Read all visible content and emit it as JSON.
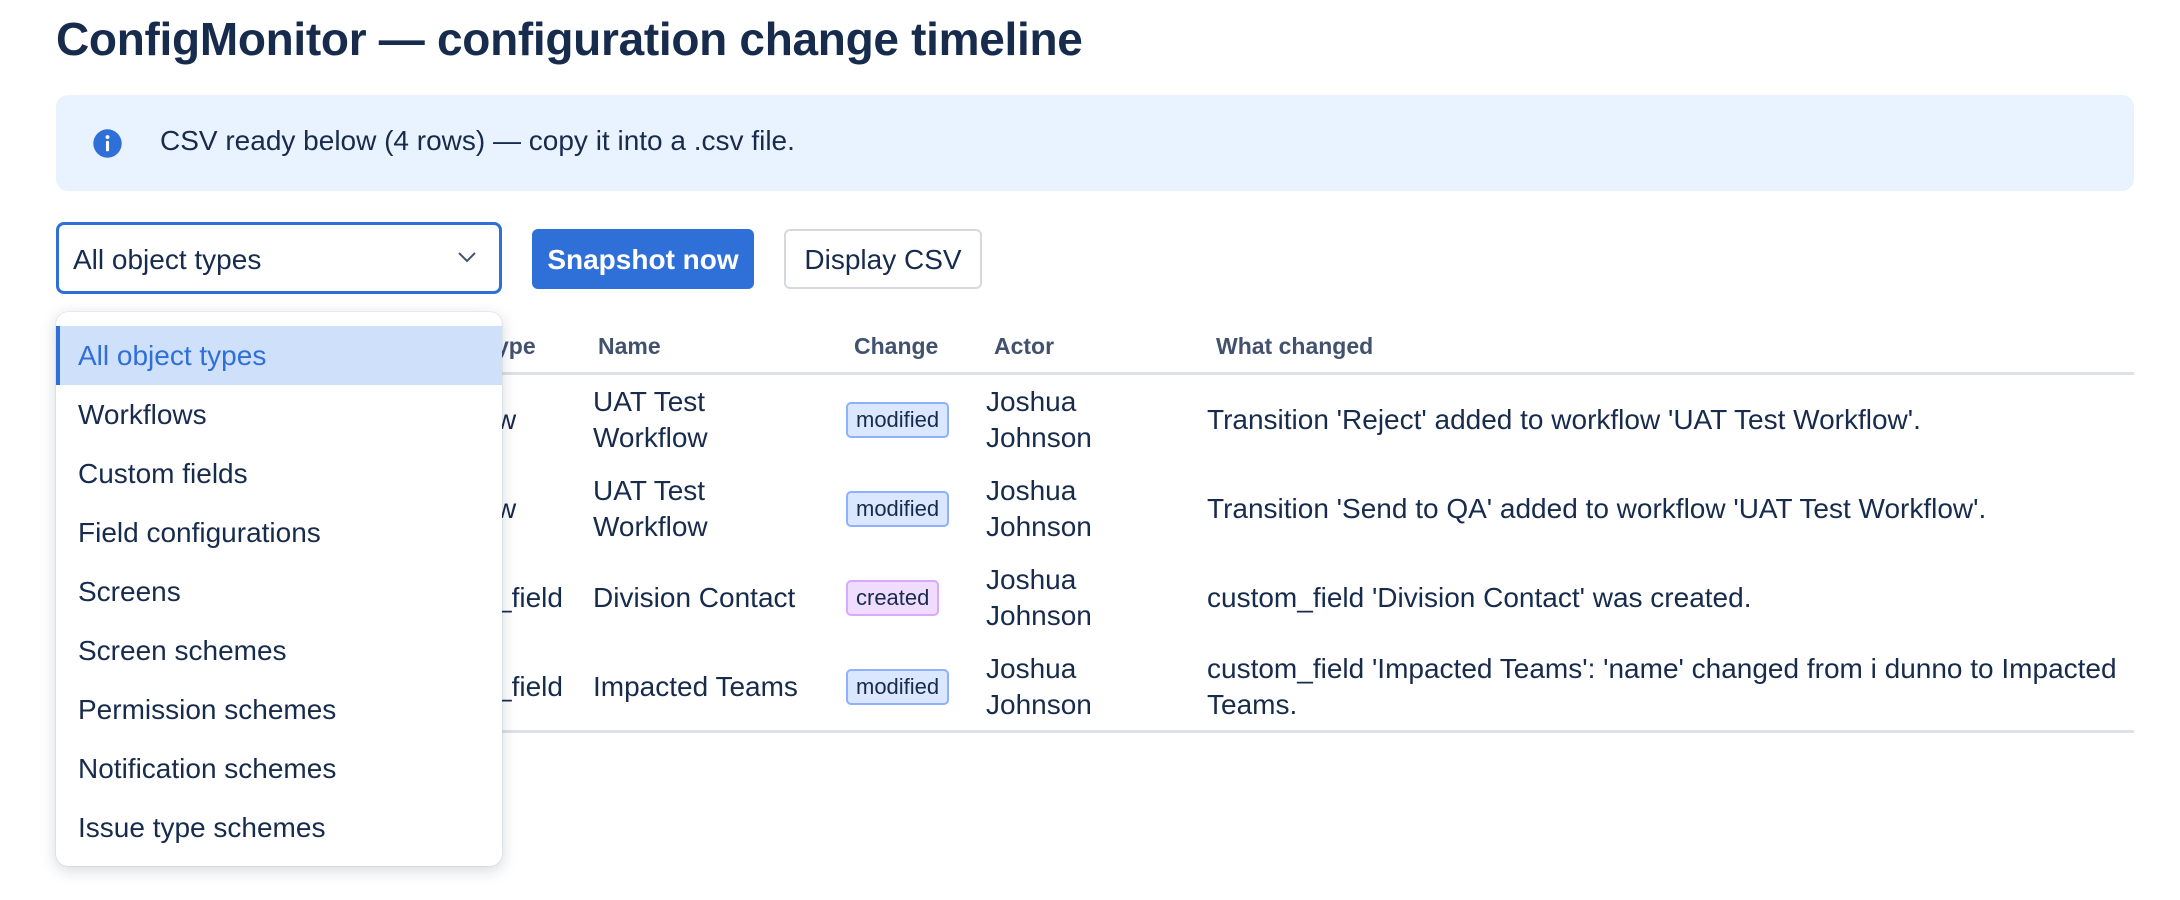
{
  "page": {
    "title": "ConfigMonitor — configuration change timeline"
  },
  "banner": {
    "icon": "info-icon",
    "message": "CSV ready below (4 rows) — copy it into a .csv file.",
    "accent_color": "#e9f2ff"
  },
  "toolbar": {
    "filter_value": "All object types",
    "snapshot_label": "Snapshot now",
    "display_csv_label": "Display CSV",
    "primary_color": "#2f6fd8"
  },
  "table": {
    "columns": [
      "ype",
      "Name",
      "Change",
      "Actor",
      "What changed"
    ],
    "rows": [
      {
        "type": "w",
        "name_line1": "UAT Test",
        "name_line2": "Workflow",
        "change": "modified",
        "actor_line1": "Joshua",
        "actor_line2": "Johnson",
        "what_line1": "Transition 'Reject' added to workflow 'UAT Test Workflow'.",
        "what_line2": ""
      },
      {
        "type": "w",
        "name_line1": "UAT Test",
        "name_line2": "Workflow",
        "change": "modified",
        "actor_line1": "Joshua",
        "actor_line2": "Johnson",
        "what_line1": "Transition 'Send to QA' added to workflow 'UAT Test Workflow'.",
        "what_line2": ""
      },
      {
        "type": "_field",
        "name_line1": "Division Contact",
        "name_line2": "",
        "change": "created",
        "actor_line1": "Joshua",
        "actor_line2": "Johnson",
        "what_line1": "custom_field 'Division Contact' was created.",
        "what_line2": ""
      },
      {
        "type": "_field",
        "name_line1": "Impacted Teams",
        "name_line2": "",
        "change": "modified",
        "actor_line1": "Joshua",
        "actor_line2": "Johnson",
        "what_line1": "custom_field 'Impacted Teams': 'name' changed from i dunno to Impacted",
        "what_line2": "Teams."
      }
    ]
  },
  "dropdown": {
    "selected": "All object types",
    "options": [
      "All object types",
      "Workflows",
      "Custom fields",
      "Field configurations",
      "Screens",
      "Screen schemes",
      "Permission schemes",
      "Notification schemes",
      "Issue type schemes"
    ]
  }
}
